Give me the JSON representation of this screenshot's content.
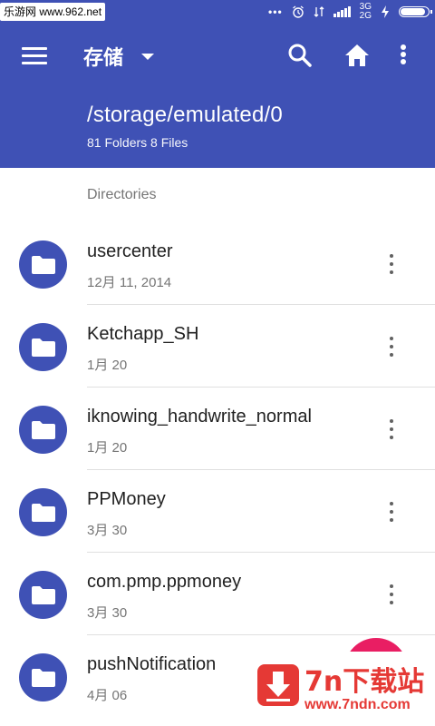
{
  "status_bar": {
    "watermark": "乐游网 www.962.net",
    "network_label": "3G\n2G",
    "battery_level_pct": 90
  },
  "app_bar": {
    "title": "存储",
    "path": "/storage/emulated/0",
    "counts": "81 Folders 8 Files",
    "icons": [
      "menu-icon",
      "chevron-down-icon",
      "search-icon",
      "home-icon",
      "more-vert-icon"
    ]
  },
  "list": {
    "section_header": "Directories",
    "items": [
      {
        "name": "usercenter",
        "date": "12月 11, 2014"
      },
      {
        "name": "Ketchapp_SH",
        "date": "1月 20"
      },
      {
        "name": "iknowing_handwrite_normal",
        "date": "1月 20"
      },
      {
        "name": "PPMoney",
        "date": "3月 30"
      },
      {
        "name": "com.pmp.ppmoney",
        "date": "3月 30"
      },
      {
        "name": "pushNotification",
        "date": "4月 06"
      }
    ]
  },
  "watermark_logo": {
    "title": "7n下载站",
    "url": "www.7ndn.com"
  },
  "colors": {
    "primary": "#3f51b5",
    "accent": "#e91e63",
    "logo_red": "#e53935"
  }
}
